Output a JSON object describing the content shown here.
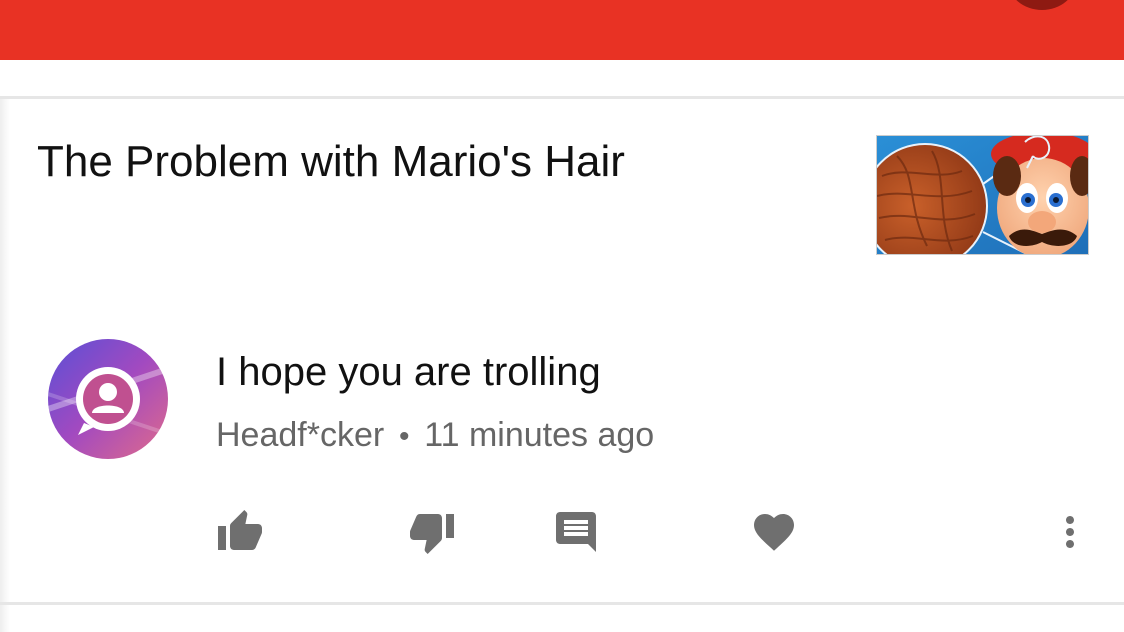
{
  "colors": {
    "app_bar": "#e83224",
    "action_icon": "#6f6f6f",
    "meta_text": "#666666"
  },
  "video": {
    "title": "The Problem with Mario's Hair"
  },
  "comment": {
    "text": "I hope you are trolling",
    "author": "Headf*cker",
    "separator": "•",
    "time": "11 minutes ago"
  },
  "actions": {
    "icons": [
      "thumb-up-icon",
      "thumb-down-icon",
      "reply-icon",
      "heart-icon",
      "more-vert-icon"
    ]
  }
}
